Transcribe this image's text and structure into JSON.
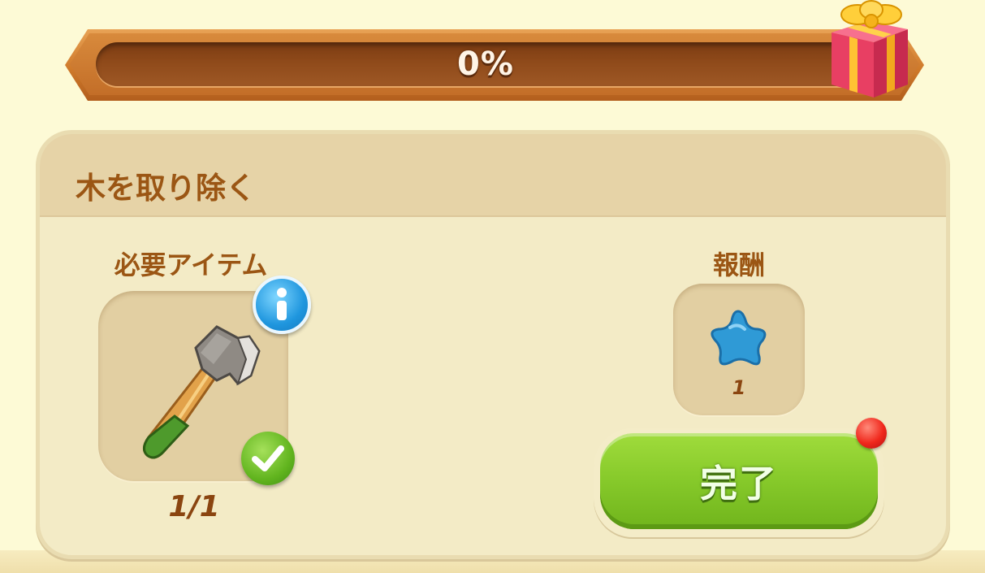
{
  "progress": {
    "percent_label": "0%",
    "value": 0
  },
  "task": {
    "title": "木を取り除く",
    "required_items_label": "必要アイテム",
    "required_item": {
      "icon": "axe-icon",
      "count": "1/1",
      "completed": true
    },
    "reward_label": "報酬",
    "reward": {
      "icon": "blue-star-icon",
      "amount": "1"
    },
    "complete_button_label": "完了"
  },
  "colors": {
    "background": "#fdfad6",
    "card": "#f3ebc6",
    "header": "#e6d3a7",
    "text_brown": "#9b5614",
    "progress_frame": "#cf7a2b",
    "progress_track": "#8f4a1a",
    "complete_green": "#86c92a",
    "info_blue": "#1f96de",
    "star_blue": "#2f9ad6",
    "notify_red": "#f0281c"
  }
}
